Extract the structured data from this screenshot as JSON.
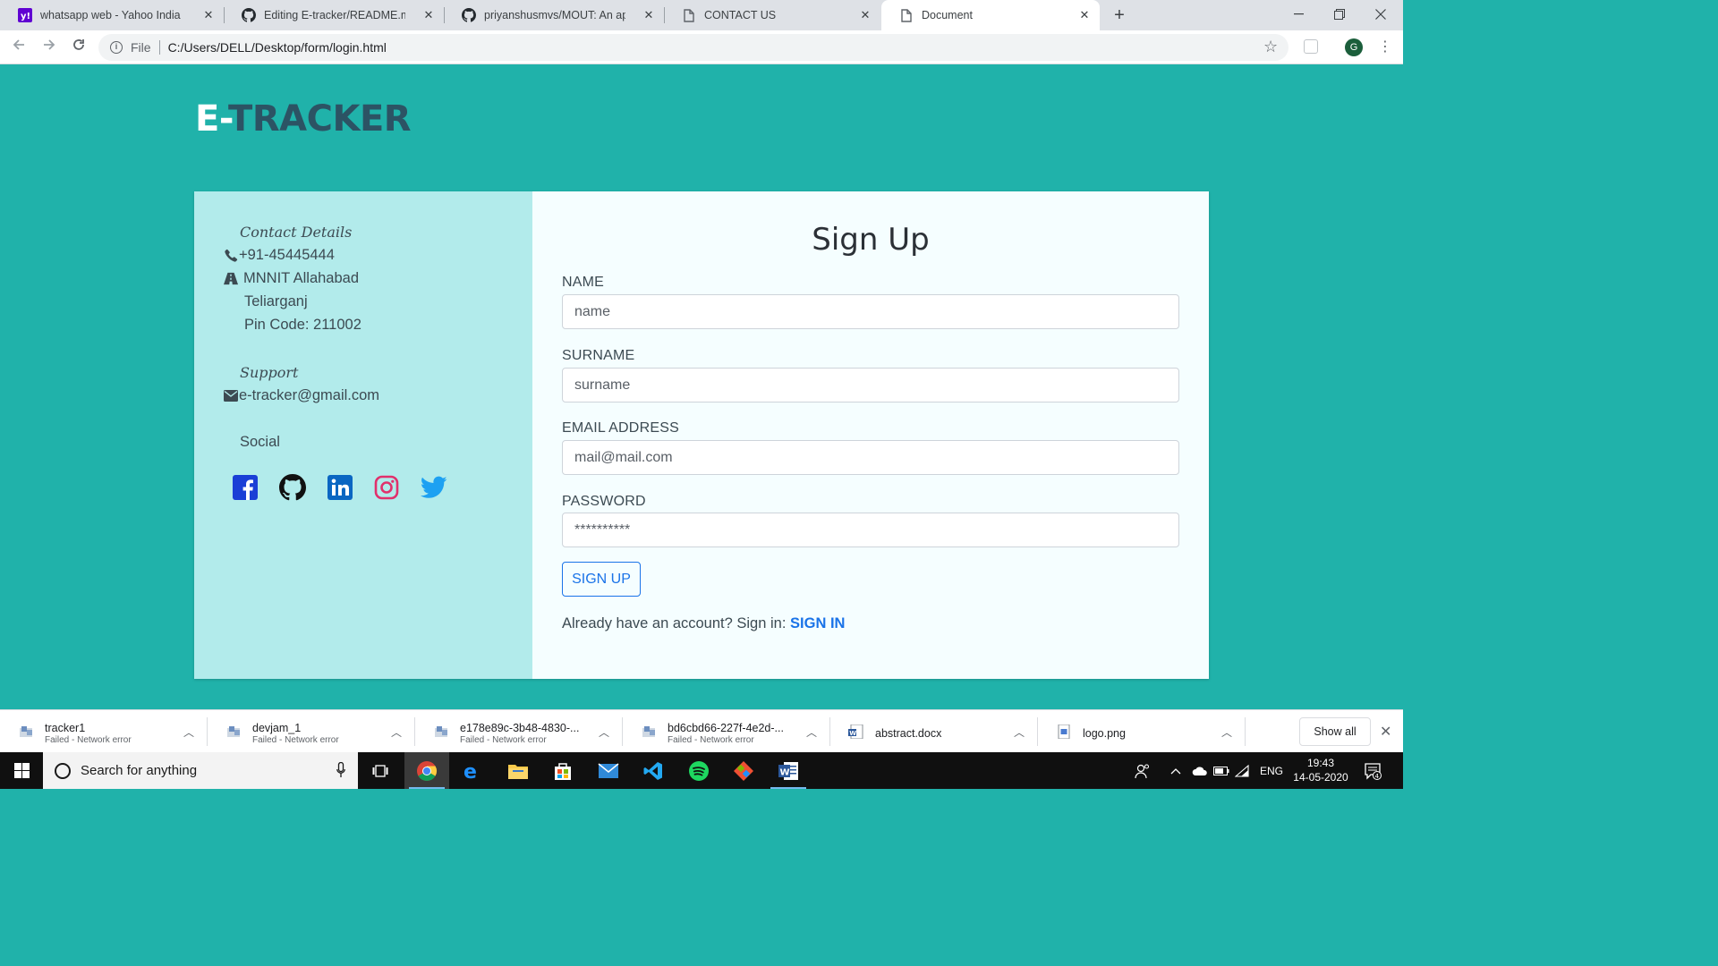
{
  "browser": {
    "tabs": [
      {
        "title": "whatsapp web - Yahoo India Search",
        "favicon": "yahoo-icon"
      },
      {
        "title": "Editing E-tracker/README.md at",
        "favicon": "github-icon"
      },
      {
        "title": "priyanshusmvs/MOUT: An app ba",
        "favicon": "github-icon"
      },
      {
        "title": "CONTACT US",
        "favicon": "document-icon"
      },
      {
        "title": "Document",
        "favicon": "document-icon",
        "active": true
      }
    ],
    "address_scheme": "File",
    "address_url": "C:/Users/DELL/Desktop/form/login.html",
    "profile_initial": "G"
  },
  "page": {
    "brand_prefix": "E-",
    "brand_suffix": "TRACKER",
    "contact": {
      "heading": "Contact Details",
      "phone": "+91-45445444",
      "address_line1": "MNNIT Allahabad",
      "address_line2": "Teliarganj",
      "address_line3": "Pin Code: 211002",
      "support_heading": "Support",
      "email": "e-tracker@gmail.com",
      "social_heading": "Social",
      "social_icons": [
        "facebook-icon",
        "github-icon",
        "linkedin-icon",
        "instagram-icon",
        "twitter-icon"
      ]
    },
    "form": {
      "title": "Sign Up",
      "name_label": "NAME",
      "name_placeholder": "name",
      "surname_label": "SURNAME",
      "surname_placeholder": "surname",
      "email_label": "EMAIL ADDRESS",
      "email_placeholder": "mail@mail.com",
      "password_label": "PASSWORD",
      "password_placeholder": "**********",
      "submit_label": "SIGN UP",
      "signin_prompt": "Already have an account? Sign in: ",
      "signin_link": "SIGN IN"
    },
    "colors": {
      "background": "#20b2aa",
      "left_panel": "#b2ebeb",
      "accent": "#1a73e8",
      "brand_dark": "#2c5364"
    }
  },
  "downloads": {
    "items": [
      {
        "name": "tracker1",
        "status": "Failed - Network error"
      },
      {
        "name": "devjam_1",
        "status": "Failed - Network error"
      },
      {
        "name": "e178e89c-3b48-4830-...",
        "status": "Failed - Network error"
      },
      {
        "name": "bd6cbd66-227f-4e2d-...",
        "status": "Failed - Network error"
      },
      {
        "name": "abstract.docx",
        "status": ""
      },
      {
        "name": "logo.png",
        "status": ""
      }
    ],
    "show_all": "Show all"
  },
  "taskbar": {
    "search_placeholder": "Search for anything",
    "language": "ENG",
    "time": "19:43",
    "date": "14-05-2020",
    "notification_count": "4"
  }
}
